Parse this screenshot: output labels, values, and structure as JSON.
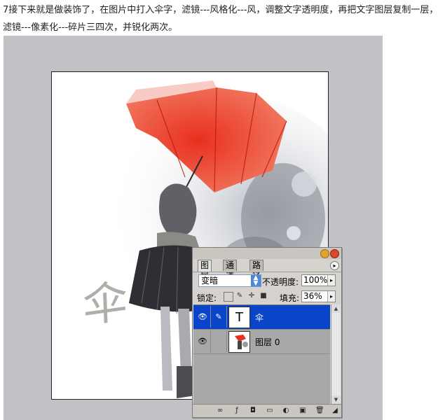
{
  "instruction": {
    "text": "7接下来就是做装饰了，在图片中打入伞字，滤镜---风格化---风，调整文字透明度，再把文字图层复制一层，滤镜---像素化---碎片三四次，并锐化两次。"
  },
  "document": {
    "overlay_text": "伞"
  },
  "layers_panel": {
    "tabs": [
      {
        "label": "图层",
        "active": true
      },
      {
        "label": "通道",
        "active": false
      },
      {
        "label": "路径",
        "active": false
      }
    ],
    "blend_mode": "变暗",
    "opacity_label": "不透明度:",
    "opacity_value": "100%",
    "lock_label": "锁定:",
    "fill_label": "填充:",
    "fill_value": "36%",
    "layers": [
      {
        "name": "伞",
        "thumb": "T",
        "selected": true
      },
      {
        "name": "图层 0",
        "thumb": "",
        "selected": false
      }
    ]
  },
  "colors": {
    "selection": "#0a44c9",
    "umbrella": "#e8301e",
    "canvas_bg": "#c2c1c6"
  }
}
